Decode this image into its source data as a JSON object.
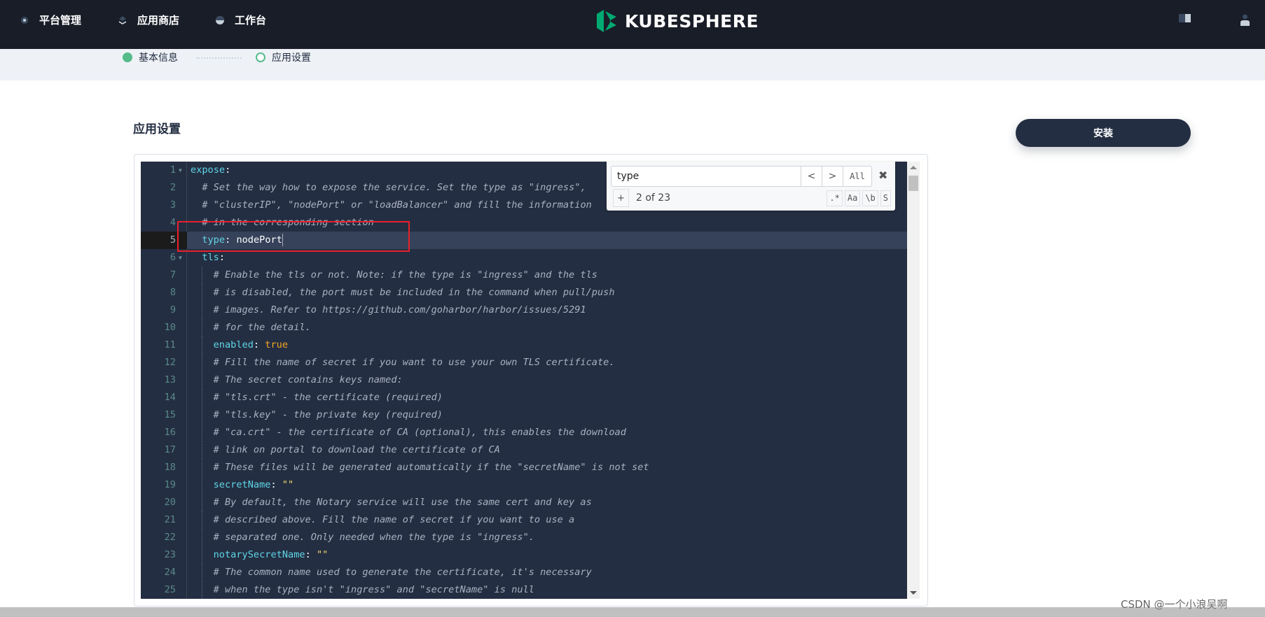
{
  "header": {
    "nav": [
      {
        "label": "平台管理",
        "icon": "gear-icon"
      },
      {
        "label": "应用商店",
        "icon": "appstore-icon"
      },
      {
        "label": "工作台",
        "icon": "workbench-icon"
      }
    ],
    "logo_text": "KUBESPHERE",
    "right_icons": [
      "book-icon",
      "user-icon"
    ]
  },
  "steps": [
    {
      "label": "基本信息",
      "state": "done"
    },
    {
      "label": "应用设置",
      "state": "current"
    }
  ],
  "page_title": "应用设置",
  "install_label": "安装",
  "search": {
    "value": "type",
    "prev": "<",
    "next": ">",
    "all": "All",
    "close": "✖",
    "plus": "+",
    "count": "2 of 23",
    "options": [
      ".*",
      "Aa",
      "\\b",
      "S"
    ]
  },
  "colors": {
    "accent": "#55bc8a",
    "dark": "#242e42",
    "key": "#5fd6e8",
    "bool": "#f5a623",
    "string": "#f5d76e"
  },
  "editor": {
    "active_line": 5,
    "lines": [
      {
        "n": "1",
        "fold": true,
        "indent": 0,
        "key": "expose"
      },
      {
        "n": "2",
        "indent": 1,
        "comment": "# Set the way how to expose the service. Set the type as \"ingress\","
      },
      {
        "n": "3",
        "indent": 1,
        "comment": "# \"clusterIP\", \"nodePort\" or \"loadBalancer\" and fill the information"
      },
      {
        "n": "4",
        "indent": 1,
        "comment": "# in the corresponding section"
      },
      {
        "n": "5",
        "indent": 1,
        "key": "type",
        "value": "nodePort",
        "vtype": "v"
      },
      {
        "n": "6",
        "fold": true,
        "indent": 1,
        "key": "tls"
      },
      {
        "n": "7",
        "indent": 2,
        "comment": "# Enable the tls or not. Note: if the type is \"ingress\" and the tls"
      },
      {
        "n": "8",
        "indent": 2,
        "comment": "# is disabled, the port must be included in the command when pull/push"
      },
      {
        "n": "9",
        "indent": 2,
        "comment": "# images. Refer to https://github.com/goharbor/harbor/issues/5291"
      },
      {
        "n": "10",
        "indent": 2,
        "comment": "# for the detail."
      },
      {
        "n": "11",
        "indent": 2,
        "key": "enabled",
        "value": "true",
        "vtype": "b"
      },
      {
        "n": "12",
        "indent": 2,
        "comment": "# Fill the name of secret if you want to use your own TLS certificate."
      },
      {
        "n": "13",
        "indent": 2,
        "comment": "# The secret contains keys named:"
      },
      {
        "n": "14",
        "indent": 2,
        "comment": "# \"tls.crt\" - the certificate (required)"
      },
      {
        "n": "15",
        "indent": 2,
        "comment": "# \"tls.key\" - the private key (required)"
      },
      {
        "n": "16",
        "indent": 2,
        "comment": "# \"ca.crt\" - the certificate of CA (optional), this enables the download"
      },
      {
        "n": "17",
        "indent": 2,
        "comment": "# link on portal to download the certificate of CA"
      },
      {
        "n": "18",
        "indent": 2,
        "comment": "# These files will be generated automatically if the \"secretName\" is not set"
      },
      {
        "n": "19",
        "indent": 2,
        "key": "secretName",
        "value": "\"\"",
        "vtype": "s"
      },
      {
        "n": "20",
        "indent": 2,
        "comment": "# By default, the Notary service will use the same cert and key as"
      },
      {
        "n": "21",
        "indent": 2,
        "comment": "# described above. Fill the name of secret if you want to use a"
      },
      {
        "n": "22",
        "indent": 2,
        "comment": "# separated one. Only needed when the type is \"ingress\"."
      },
      {
        "n": "23",
        "indent": 2,
        "key": "notarySecretName",
        "value": "\"\"",
        "vtype": "s"
      },
      {
        "n": "24",
        "indent": 2,
        "comment": "# The common name used to generate the certificate, it's necessary"
      },
      {
        "n": "25",
        "indent": 2,
        "comment": "# when the type isn't \"ingress\" and \"secretName\" is null"
      }
    ]
  },
  "watermark": "CSDN @一个小浪吴啊"
}
